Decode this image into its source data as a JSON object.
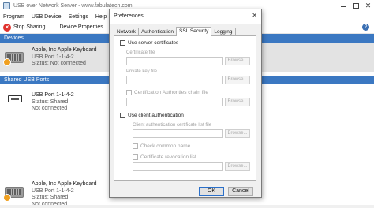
{
  "window": {
    "title": "USB over Network Server - www.fabulatech.com"
  },
  "menu": [
    "Program",
    "USB Device",
    "Settings",
    "Help"
  ],
  "toolbar": {
    "stop_sharing": "Stop Sharing",
    "device_properties": "Device Properties"
  },
  "sections": {
    "devices": "Devices",
    "shared": "Shared USB Ports"
  },
  "devices": [
    {
      "name": "Apple, Inc Apple Keyboard",
      "port": "USB Port  1-1-4-2",
      "status": "Status: Not connected"
    }
  ],
  "shared_ports": [
    {
      "name": "USB Port  1-1-4-2",
      "status": "Status: Shared",
      "note": "Not connected"
    },
    {
      "name": "Apple, Inc Apple Keyboard",
      "port": "USB Port  1-1-4-2",
      "status": "Status: Shared",
      "note": "Not connected"
    }
  ],
  "dialog": {
    "title": "Preferences",
    "tabs": [
      "Network",
      "Authentication",
      "SSL Security",
      "Logging"
    ],
    "active_tab": "SSL Security",
    "use_server_certificates": "Use server certificates",
    "certificate_file": "Certificate file",
    "private_key_file": "Private key file",
    "ca_chain_file": "Certification Authorities chain file",
    "use_client_auth": "Use client authentication",
    "client_auth_list_file": "Client authentication certificate list file",
    "check_common_name": "Check common name",
    "cert_revocation_list": "Certificate revocation list",
    "browse": "Browse...",
    "ok": "OK",
    "cancel": "Cancel"
  },
  "colors": {
    "section_header": "#3b78c2",
    "stop_icon": "#e0332e",
    "selected_row": "#e3e3e3"
  }
}
